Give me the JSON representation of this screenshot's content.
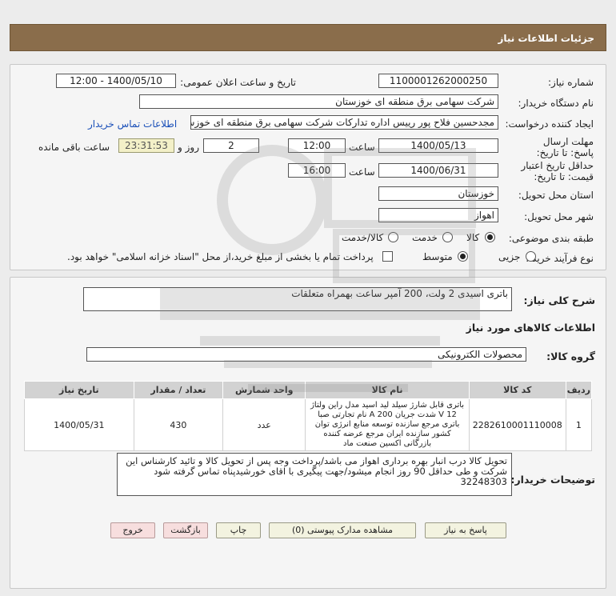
{
  "header": {
    "title": "جزئیات اطلاعات نیاز"
  },
  "form": {
    "need_number": {
      "label": "شماره نیاز:",
      "value": "1100001262000250"
    },
    "announce_datetime": {
      "label": "تاریخ و ساعت اعلان عمومی:",
      "value": "1400/05/10 - 12:00"
    },
    "buyer_org": {
      "label": "نام دستگاه خریدار:",
      "value": "شرکت سهامی برق منطقه ای خوزستان"
    },
    "requester": {
      "label": "ایجاد کننده درخواست:",
      "value": "مجدحسین فلاح پور رییس اداره تدارکات شرکت سهامی برق منطقه ای خوزستان",
      "contact_link": "اطلاعات تماس خریدار"
    },
    "deadline": {
      "label": "مهلت ارسال پاسخ: تا تاریخ:",
      "date": "1400/05/13",
      "time_label": "ساعت",
      "time": "12:00",
      "days": "2",
      "days_label": "روز و",
      "remaining": "23:31:53",
      "remaining_label": "ساعت باقی مانده"
    },
    "validity": {
      "label": "حداقل تاریخ اعتبار قیمت: تا تاریخ:",
      "date": "1400/06/31",
      "time_label": "ساعت",
      "time": "16:00"
    },
    "province": {
      "label": "استان محل تحویل:",
      "value": "خوزستان"
    },
    "city": {
      "label": "شهر محل تحویل:",
      "value": "اهواز"
    },
    "category": {
      "label": "طبقه بندی موضوعی:",
      "options": [
        "کالا",
        "خدمت",
        "کالا/خدمت"
      ],
      "selected": "کالا"
    },
    "process": {
      "label": "نوع فرآیند خرید :",
      "options": [
        "جزیی",
        "متوسط"
      ],
      "selected": "متوسط",
      "payment_note": "پرداخت تمام یا بخشی از مبلغ خرید،از محل \"اسناد خزانه اسلامی\" خواهد بود."
    }
  },
  "summary": {
    "label": "شرح کلی نیاز:",
    "value": "باتری اسیدی 2 ولت، 200 آمپر ساعت بهمراه متعلقات"
  },
  "goods_info_title": "اطلاعات کالاهای مورد نیاز",
  "goods_group": {
    "label": "گروه کالا:",
    "value": "محصولات الکترونیکی"
  },
  "table": {
    "headers": [
      "ردیف",
      "کد کالا",
      "نام کالا",
      "واحد شمارش",
      "تعداد / مقدار",
      "تاریخ نیاز"
    ],
    "rows": [
      {
        "row": "1",
        "code": "2282610001110008",
        "name": "باتری قابل شارژ سیلد لید اسید مدل راین ولتاژ 12 V شدت جریان 200 A نام تجارتی صبا باتری مرجع سازنده توسعه منابع انرژی توان کشور سازنده ایران مرجع عرضه کننده بازرگانی اکسین صنعت ماد",
        "unit": "عدد",
        "qty": "430",
        "date": "1400/05/31"
      }
    ]
  },
  "buyer_notes": {
    "label": "توضیحات خریدار:",
    "value": "تحویل کالا درب انبار بهره برداری اهواز می باشد/پرداخت وجه پس از تحویل کالا و تائید کارشناس این شرکت و طی حداقل 90 روز انجام میشود/جهت پیگیری با اقای خورشیدپناه تماس گرفته شود 32248303"
  },
  "buttons": {
    "reply": "پاسخ به نیاز",
    "docs": "مشاهده مدارک پیوستی (0)",
    "print": "چاپ",
    "back": "بازگشت",
    "exit": "خروج"
  }
}
